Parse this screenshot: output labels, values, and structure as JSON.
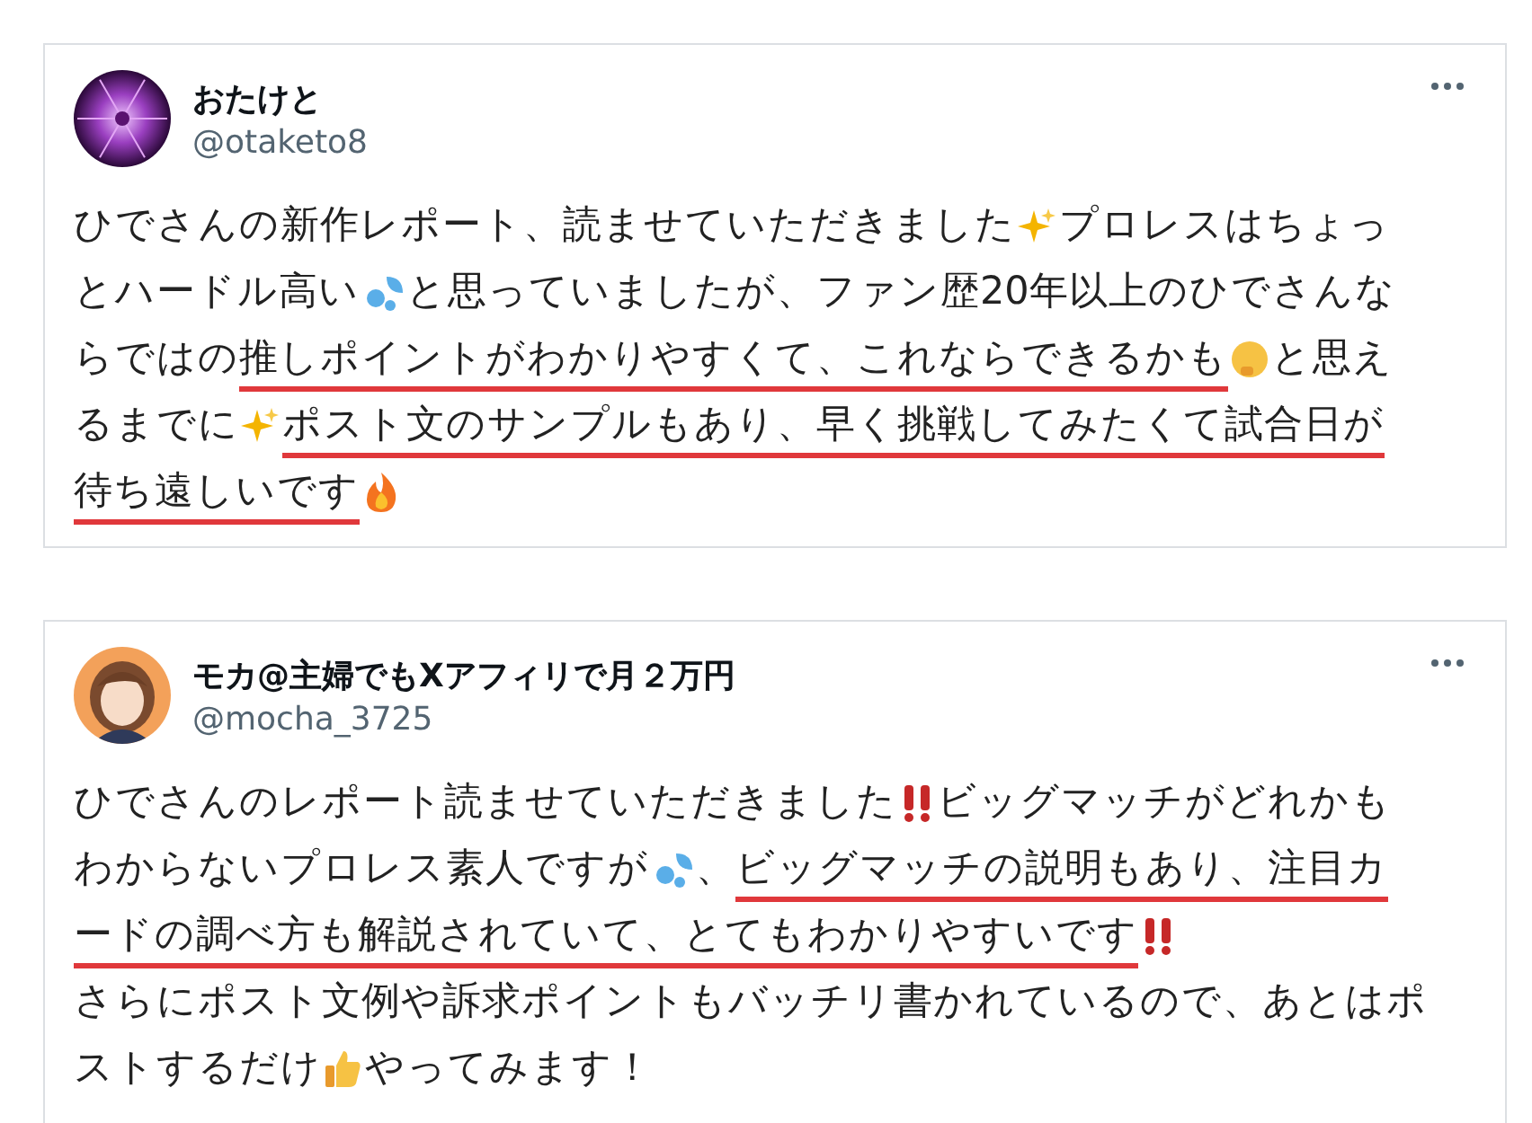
{
  "posts": [
    {
      "name": "おたけと",
      "handle": "@otaketo8",
      "lines": [
        [
          {
            "kind": "text",
            "text": "ひでさんの新作レポート、読ませていただきました",
            "underlined": false
          },
          {
            "kind": "sparkle"
          },
          {
            "kind": "text",
            "text": "プロレスはちょっ",
            "underlined": false
          }
        ],
        [
          {
            "kind": "text",
            "text": "とハードル高い",
            "underlined": false
          },
          {
            "kind": "sweat"
          },
          {
            "kind": "text",
            "text": "と思っていましたが、ファン歴20年以上のひでさんな",
            "underlined": false
          }
        ],
        [
          {
            "kind": "text",
            "text": "らではの",
            "underlined": false
          },
          {
            "kind": "text",
            "text": "推しポイントがわかりやすくて、これならできるかも",
            "underlined": true
          },
          {
            "kind": "thinking"
          },
          {
            "kind": "text",
            "text": "と思え",
            "underlined": false
          }
        ],
        [
          {
            "kind": "text",
            "text": "るまでに",
            "underlined": false
          },
          {
            "kind": "sparkle"
          },
          {
            "kind": "text",
            "text": "ポスト文のサンプルもあり、早く挑戦してみたくて試合日が",
            "underlined": true
          }
        ],
        [
          {
            "kind": "text",
            "text": "待ち遠しいです",
            "underlined": true
          },
          {
            "kind": "fire"
          }
        ]
      ]
    },
    {
      "name": "モカ@主婦でもXアフィリで月２万円",
      "handle": "@mocha_3725",
      "lines": [
        [
          {
            "kind": "text",
            "text": "ひでさんのレポート読ませていただきました",
            "underlined": false
          },
          {
            "kind": "exclaim"
          },
          {
            "kind": "text",
            "text": "ビッグマッチがどれかも",
            "underlined": false
          }
        ],
        [
          {
            "kind": "text",
            "text": "わからないプロレス素人ですが",
            "underlined": false
          },
          {
            "kind": "sweat"
          },
          {
            "kind": "text",
            "text": "、",
            "underlined": false
          },
          {
            "kind": "text",
            "text": "ビッグマッチの説明もあり、注目カ",
            "underlined": true
          }
        ],
        [
          {
            "kind": "text",
            "text": "ードの調べ方も解説されていて、とてもわかりやすいです",
            "underlined": true
          },
          {
            "kind": "exclaim"
          }
        ],
        [
          {
            "kind": "text",
            "text": "さらにポスト文例や訴求ポイントもバッチリ書かれているので、あとはポ",
            "underlined": false
          }
        ],
        [
          {
            "kind": "text",
            "text": "ストするだけ",
            "underlined": false
          },
          {
            "kind": "thumb"
          },
          {
            "kind": "text",
            "text": "やってみます！",
            "underlined": false
          }
        ]
      ]
    }
  ]
}
